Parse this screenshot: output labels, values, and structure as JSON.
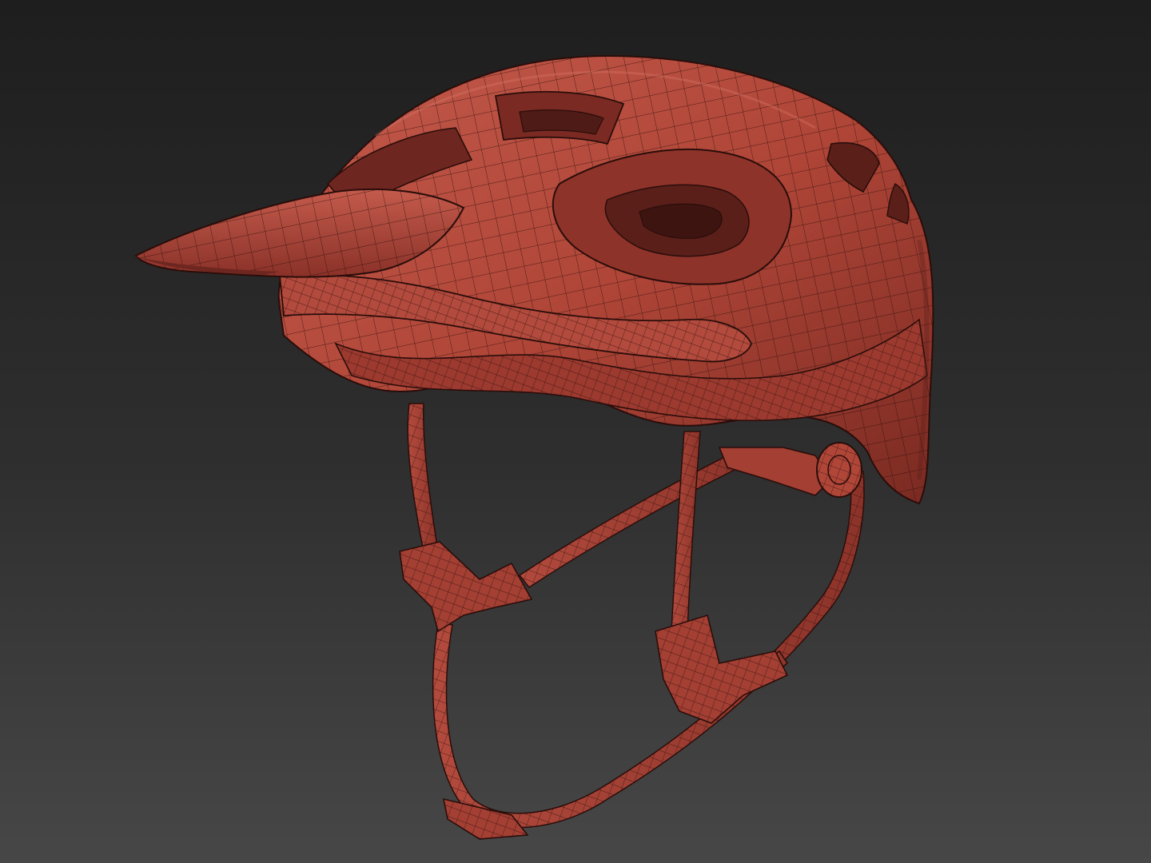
{
  "scene": {
    "background_top": "#1e1e1e",
    "background_bottom": "#474747",
    "model_color": "#b5483c",
    "model_shadow": "#6e2620",
    "wire_color": "#2a0d0a",
    "model_name_icon": "helmet-wireframe"
  }
}
